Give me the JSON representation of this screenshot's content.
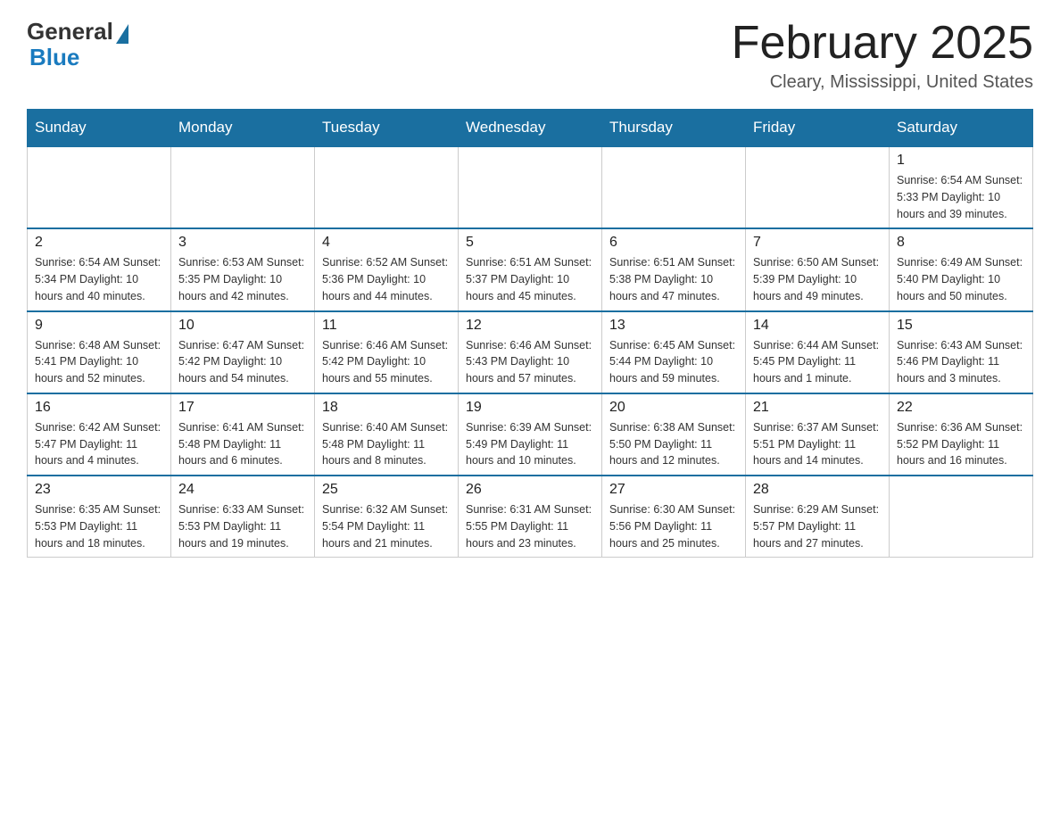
{
  "logo": {
    "general": "General",
    "blue": "Blue"
  },
  "title": "February 2025",
  "location": "Cleary, Mississippi, United States",
  "days_of_week": [
    "Sunday",
    "Monday",
    "Tuesday",
    "Wednesday",
    "Thursday",
    "Friday",
    "Saturday"
  ],
  "weeks": [
    [
      {
        "day": "",
        "info": ""
      },
      {
        "day": "",
        "info": ""
      },
      {
        "day": "",
        "info": ""
      },
      {
        "day": "",
        "info": ""
      },
      {
        "day": "",
        "info": ""
      },
      {
        "day": "",
        "info": ""
      },
      {
        "day": "1",
        "info": "Sunrise: 6:54 AM\nSunset: 5:33 PM\nDaylight: 10 hours\nand 39 minutes."
      }
    ],
    [
      {
        "day": "2",
        "info": "Sunrise: 6:54 AM\nSunset: 5:34 PM\nDaylight: 10 hours\nand 40 minutes."
      },
      {
        "day": "3",
        "info": "Sunrise: 6:53 AM\nSunset: 5:35 PM\nDaylight: 10 hours\nand 42 minutes."
      },
      {
        "day": "4",
        "info": "Sunrise: 6:52 AM\nSunset: 5:36 PM\nDaylight: 10 hours\nand 44 minutes."
      },
      {
        "day": "5",
        "info": "Sunrise: 6:51 AM\nSunset: 5:37 PM\nDaylight: 10 hours\nand 45 minutes."
      },
      {
        "day": "6",
        "info": "Sunrise: 6:51 AM\nSunset: 5:38 PM\nDaylight: 10 hours\nand 47 minutes."
      },
      {
        "day": "7",
        "info": "Sunrise: 6:50 AM\nSunset: 5:39 PM\nDaylight: 10 hours\nand 49 minutes."
      },
      {
        "day": "8",
        "info": "Sunrise: 6:49 AM\nSunset: 5:40 PM\nDaylight: 10 hours\nand 50 minutes."
      }
    ],
    [
      {
        "day": "9",
        "info": "Sunrise: 6:48 AM\nSunset: 5:41 PM\nDaylight: 10 hours\nand 52 minutes."
      },
      {
        "day": "10",
        "info": "Sunrise: 6:47 AM\nSunset: 5:42 PM\nDaylight: 10 hours\nand 54 minutes."
      },
      {
        "day": "11",
        "info": "Sunrise: 6:46 AM\nSunset: 5:42 PM\nDaylight: 10 hours\nand 55 minutes."
      },
      {
        "day": "12",
        "info": "Sunrise: 6:46 AM\nSunset: 5:43 PM\nDaylight: 10 hours\nand 57 minutes."
      },
      {
        "day": "13",
        "info": "Sunrise: 6:45 AM\nSunset: 5:44 PM\nDaylight: 10 hours\nand 59 minutes."
      },
      {
        "day": "14",
        "info": "Sunrise: 6:44 AM\nSunset: 5:45 PM\nDaylight: 11 hours\nand 1 minute."
      },
      {
        "day": "15",
        "info": "Sunrise: 6:43 AM\nSunset: 5:46 PM\nDaylight: 11 hours\nand 3 minutes."
      }
    ],
    [
      {
        "day": "16",
        "info": "Sunrise: 6:42 AM\nSunset: 5:47 PM\nDaylight: 11 hours\nand 4 minutes."
      },
      {
        "day": "17",
        "info": "Sunrise: 6:41 AM\nSunset: 5:48 PM\nDaylight: 11 hours\nand 6 minutes."
      },
      {
        "day": "18",
        "info": "Sunrise: 6:40 AM\nSunset: 5:48 PM\nDaylight: 11 hours\nand 8 minutes."
      },
      {
        "day": "19",
        "info": "Sunrise: 6:39 AM\nSunset: 5:49 PM\nDaylight: 11 hours\nand 10 minutes."
      },
      {
        "day": "20",
        "info": "Sunrise: 6:38 AM\nSunset: 5:50 PM\nDaylight: 11 hours\nand 12 minutes."
      },
      {
        "day": "21",
        "info": "Sunrise: 6:37 AM\nSunset: 5:51 PM\nDaylight: 11 hours\nand 14 minutes."
      },
      {
        "day": "22",
        "info": "Sunrise: 6:36 AM\nSunset: 5:52 PM\nDaylight: 11 hours\nand 16 minutes."
      }
    ],
    [
      {
        "day": "23",
        "info": "Sunrise: 6:35 AM\nSunset: 5:53 PM\nDaylight: 11 hours\nand 18 minutes."
      },
      {
        "day": "24",
        "info": "Sunrise: 6:33 AM\nSunset: 5:53 PM\nDaylight: 11 hours\nand 19 minutes."
      },
      {
        "day": "25",
        "info": "Sunrise: 6:32 AM\nSunset: 5:54 PM\nDaylight: 11 hours\nand 21 minutes."
      },
      {
        "day": "26",
        "info": "Sunrise: 6:31 AM\nSunset: 5:55 PM\nDaylight: 11 hours\nand 23 minutes."
      },
      {
        "day": "27",
        "info": "Sunrise: 6:30 AM\nSunset: 5:56 PM\nDaylight: 11 hours\nand 25 minutes."
      },
      {
        "day": "28",
        "info": "Sunrise: 6:29 AM\nSunset: 5:57 PM\nDaylight: 11 hours\nand 27 minutes."
      },
      {
        "day": "",
        "info": ""
      }
    ]
  ]
}
